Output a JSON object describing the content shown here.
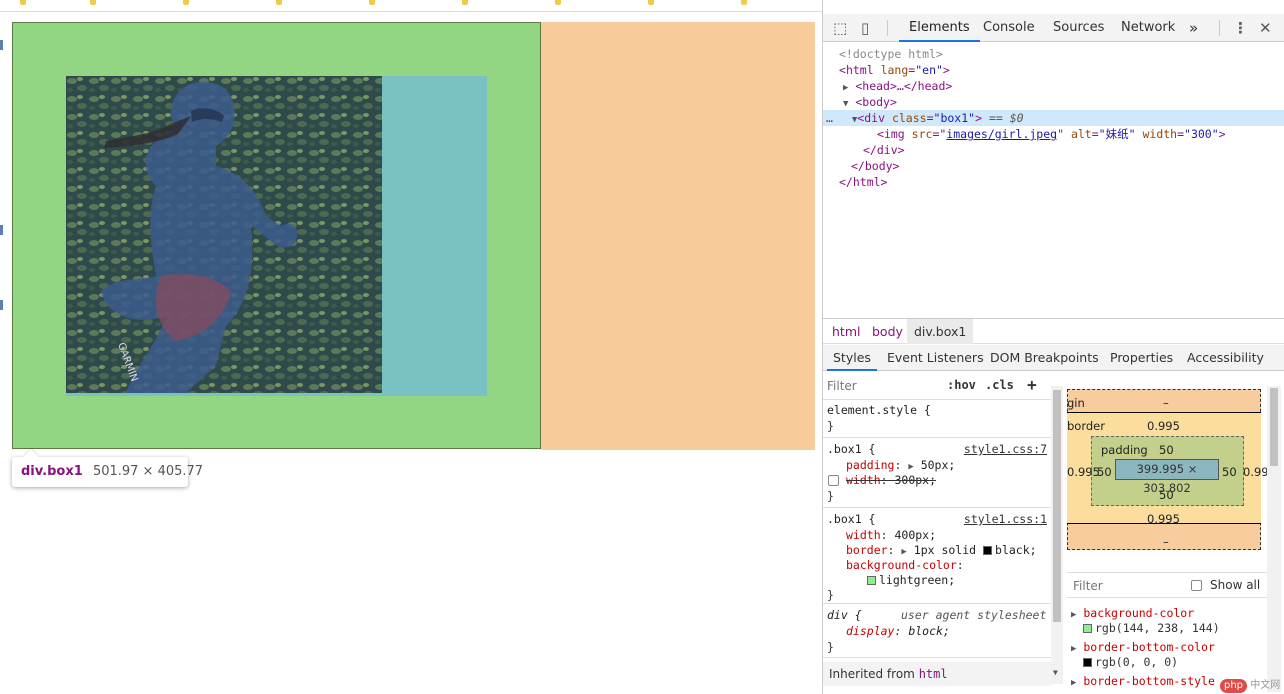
{
  "page": {
    "tooltip": {
      "name": "div.box1",
      "size": "501.97 × 405.77"
    }
  },
  "devtools": {
    "tabs": [
      "Elements",
      "Console",
      "Sources",
      "Network"
    ],
    "more_tabs": "»",
    "dom": {
      "doctype": "<!doctype html>",
      "html_open": {
        "tag": "html",
        "attr": "lang",
        "val": "\"en\""
      },
      "head": "<head>…</head>",
      "body_open": "<body>",
      "div_line": {
        "tag": "div",
        "attr": "class",
        "val": "\"box1\"",
        "eq": "== $0"
      },
      "img_line": {
        "tag": "img",
        "src_attr": "src",
        "src_val": "images/girl.jpeg",
        "alt_attr": "alt",
        "alt_val": "\"妹纸\"",
        "width_attr": "width",
        "width_val": "\"300\""
      },
      "div_close": "</div>",
      "body_close": "</body>",
      "html_close": "</html>",
      "ellipsis": "…"
    },
    "breadcrumb": [
      "html",
      "body",
      "div.box1"
    ],
    "sub_tabs": [
      "Styles",
      "Event Listeners",
      "DOM Breakpoints",
      "Properties",
      "Accessibility"
    ],
    "styles": {
      "filter_placeholder": "Filter",
      "hov": ":hov",
      "cls": ".cls",
      "add": "+",
      "element_style": "element.style {",
      "close_brace": "}",
      "rule1": {
        "selector": ".box1 {",
        "source": "style1.css:7",
        "p1": "padding",
        "v1": "50px;",
        "p2": "width",
        "v2": "300px;"
      },
      "rule2": {
        "selector": ".box1 {",
        "source": "style1.css:1",
        "p1": "width",
        "v1": "400px;",
        "p2": "border",
        "v2": "1px solid",
        "v2b": "black;",
        "p3": "background-color",
        "v3": "lightgreen;"
      },
      "rule3": {
        "selector": "div {",
        "note": "user agent stylesheet",
        "p1": "display",
        "v1": "block;"
      },
      "inherited_label": "Inherited from",
      "inherited_tag": "html"
    },
    "box_model": {
      "margin_label": "gin",
      "margin_top": "–",
      "margin_bottom": "–",
      "border_label": "border",
      "border_top": "0.995",
      "border_bottom": "0.995",
      "border_left": "0.995",
      "border_right": "0.99",
      "padding_label": "padding",
      "padding_top": "50",
      "padding_bottom": "50",
      "padding_left": "50",
      "padding_right": "50",
      "content": "399.995 × 303.802"
    },
    "computed": {
      "filter_placeholder": "Filter",
      "show_all": "Show all",
      "props": [
        {
          "name": "background-color",
          "value": "rgb(144, 238, 144)",
          "color": "#90ee90"
        },
        {
          "name": "border-bottom-color",
          "value": "rgb(0, 0, 0)",
          "color": "#000000"
        },
        {
          "name": "border-bottom-style",
          "value": ""
        }
      ]
    },
    "colors": {
      "lightgreen": "#90ee90",
      "black": "#000000",
      "accent": "#1a73e8"
    }
  },
  "watermark": {
    "logo": "php",
    "text": "中文网"
  }
}
